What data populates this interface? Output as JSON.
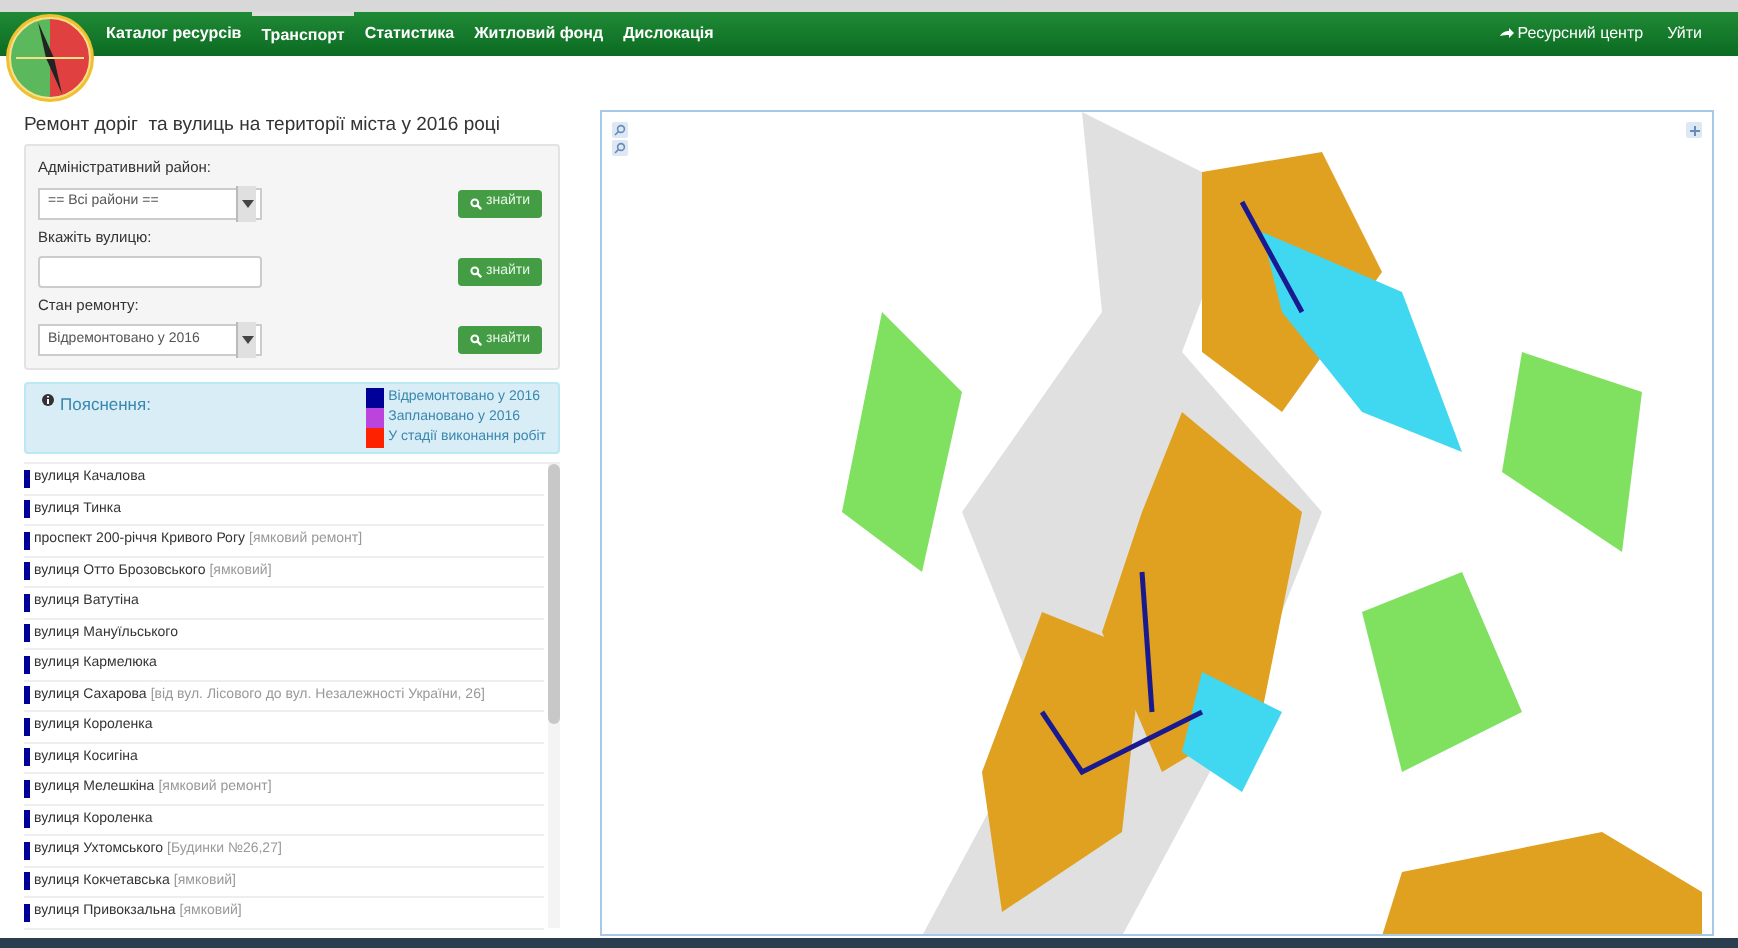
{
  "nav": {
    "items": [
      {
        "label": "Каталог ресурсів",
        "selected": false
      },
      {
        "label": "Транспорт",
        "selected": true
      },
      {
        "label": "Статистика",
        "selected": false
      },
      {
        "label": "Житловий фонд",
        "selected": false
      },
      {
        "label": "Дислокація",
        "selected": false
      }
    ],
    "right": [
      {
        "label": "Ресурсний центр",
        "kind": "icon"
      },
      {
        "label": "Уйти",
        "kind": "plain"
      }
    ]
  },
  "title": "Ремонт доріг  та вулиць на території міста у 2016 році",
  "filters": [
    {
      "label": "Адміністративний район:",
      "kind": "select",
      "value": "== Всі райони ==",
      "button": "знайти"
    },
    {
      "label": "Вкажіть вулицю:",
      "kind": "input",
      "button": "знайти"
    },
    {
      "label": "Стан ремонту:",
      "kind": "select",
      "value": "Відремонтовано у 2016",
      "button": "знайти"
    }
  ],
  "legend": {
    "title": "Пояснення:",
    "items": [
      {
        "label": "Відремонтовано у 2016",
        "color": "#000099"
      },
      {
        "label": "Заплановано у 2016",
        "color": "#bb44dd"
      },
      {
        "label": "У стадії виконання робіт",
        "color": "#ff2200"
      }
    ]
  },
  "streets": [
    {
      "name": "вулиця Качалова",
      "color": "#000099"
    },
    {
      "name": "вулиця Тинка",
      "color": "#000099"
    },
    {
      "name": "проспект 200-річчя Кривого Рогу",
      "note": "[ямковий ремонт]",
      "color": "#000099"
    },
    {
      "name": "вулиця Отто Брозовського",
      "note": "[ямковий]",
      "color": "#000099"
    },
    {
      "name": "вулиця Ватутіна",
      "color": "#000099"
    },
    {
      "name": "вулиця Мануїльського",
      "color": "#000099"
    },
    {
      "name": "вулиця Кармелюка",
      "color": "#000099"
    },
    {
      "name": "вулиця Сахарова",
      "note": "[від вул. Лісового до вул. Незалежності України, 26]",
      "color": "#000099"
    },
    {
      "name": "вулиця Короленка",
      "color": "#000099"
    },
    {
      "name": "вулиця Косигіна",
      "color": "#000099"
    },
    {
      "name": "вулиця Мелешкіна",
      "note": "[ямковий ремонт]",
      "color": "#000099"
    },
    {
      "name": "вулиця Короленка",
      "color": "#000099"
    },
    {
      "name": "вулиця Ухтомського",
      "note": "[Будинки №26,27]",
      "color": "#000099"
    },
    {
      "name": "вулиця Кокчетавська",
      "note": "[ямковий]",
      "color": "#000099"
    },
    {
      "name": "вулиця Привокзальна",
      "note": "[ямковий]",
      "color": "#000099"
    }
  ]
}
